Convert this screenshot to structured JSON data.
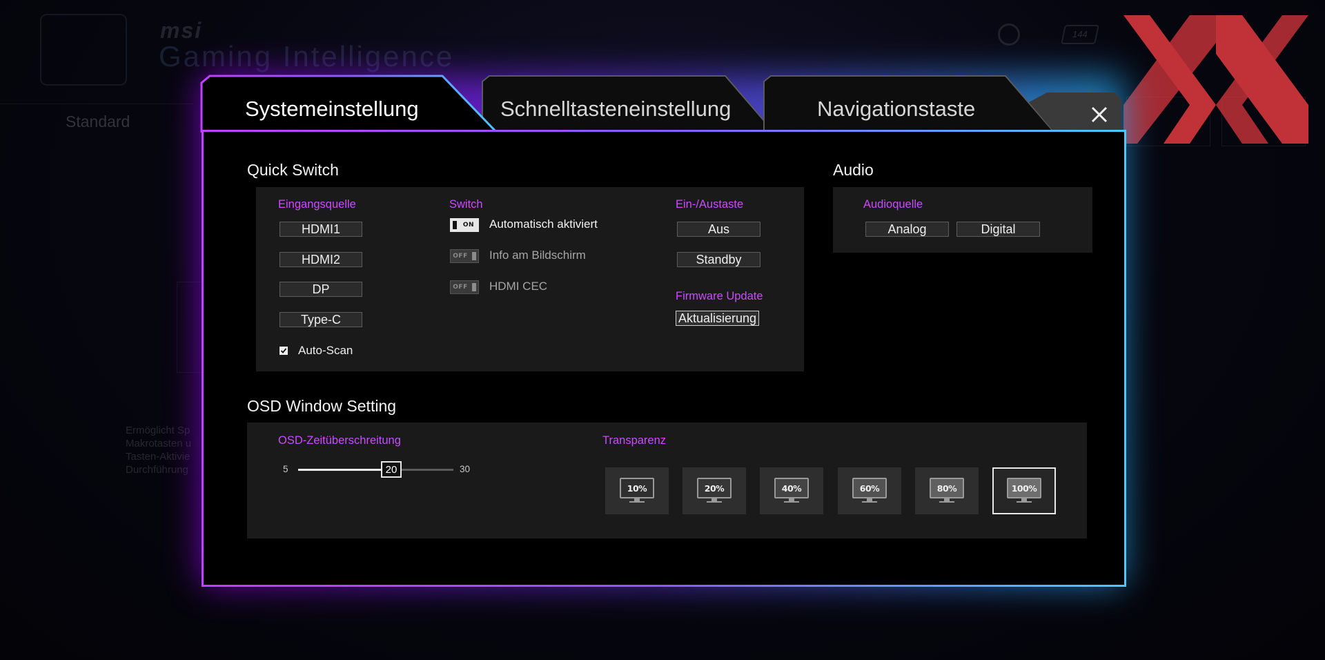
{
  "background": {
    "brand": "msi",
    "app_title": "Gaming Intelligence",
    "mode_tab": "Standard",
    "refresh_badge": "144",
    "description": "Ermöglicht Sp\nMakrotasten u\nTasten-Aktivie\nDurchführung"
  },
  "watermark": {
    "color": "#d0353c"
  },
  "tabs": [
    {
      "label": "Systemeinstellung",
      "active": true
    },
    {
      "label": "Schnelltasteneinstellung",
      "active": false
    },
    {
      "label": "Navigationstaste",
      "active": false
    }
  ],
  "quick_switch": {
    "title": "Quick Switch",
    "input_source": {
      "heading": "Eingangsquelle",
      "options": [
        "HDMI1",
        "HDMI2",
        "DP",
        "Type-C"
      ],
      "auto_scan": {
        "label": "Auto-Scan",
        "checked": true
      }
    },
    "switch": {
      "heading": "Switch",
      "items": [
        {
          "label": "Automatisch aktiviert",
          "state": "ON"
        },
        {
          "label": "Info am Bildschirm",
          "state": "OFF"
        },
        {
          "label": "HDMI CEC",
          "state": "OFF"
        }
      ]
    },
    "power_key": {
      "heading": "Ein-/Austaste",
      "options": [
        "Aus",
        "Standby"
      ]
    },
    "firmware": {
      "heading": "Firmware Update",
      "button": "Aktualisierung"
    }
  },
  "audio": {
    "title": "Audio",
    "heading": "Audioquelle",
    "options": [
      "Analog",
      "Digital"
    ]
  },
  "osd": {
    "title": "OSD Window Setting",
    "timeout": {
      "heading": "OSD-Zeitüberschreitung",
      "min": "5",
      "max": "30",
      "value": "20",
      "min_num": 5,
      "max_num": 30,
      "value_num": 20
    },
    "transparency": {
      "heading": "Transparenz",
      "options": [
        "10%",
        "20%",
        "40%",
        "60%",
        "80%",
        "100%"
      ],
      "selected": "100%"
    }
  },
  "colors": {
    "accent_purple": "#c94cff",
    "frame_left": "#c040ff",
    "frame_right": "#4ac8ff"
  }
}
